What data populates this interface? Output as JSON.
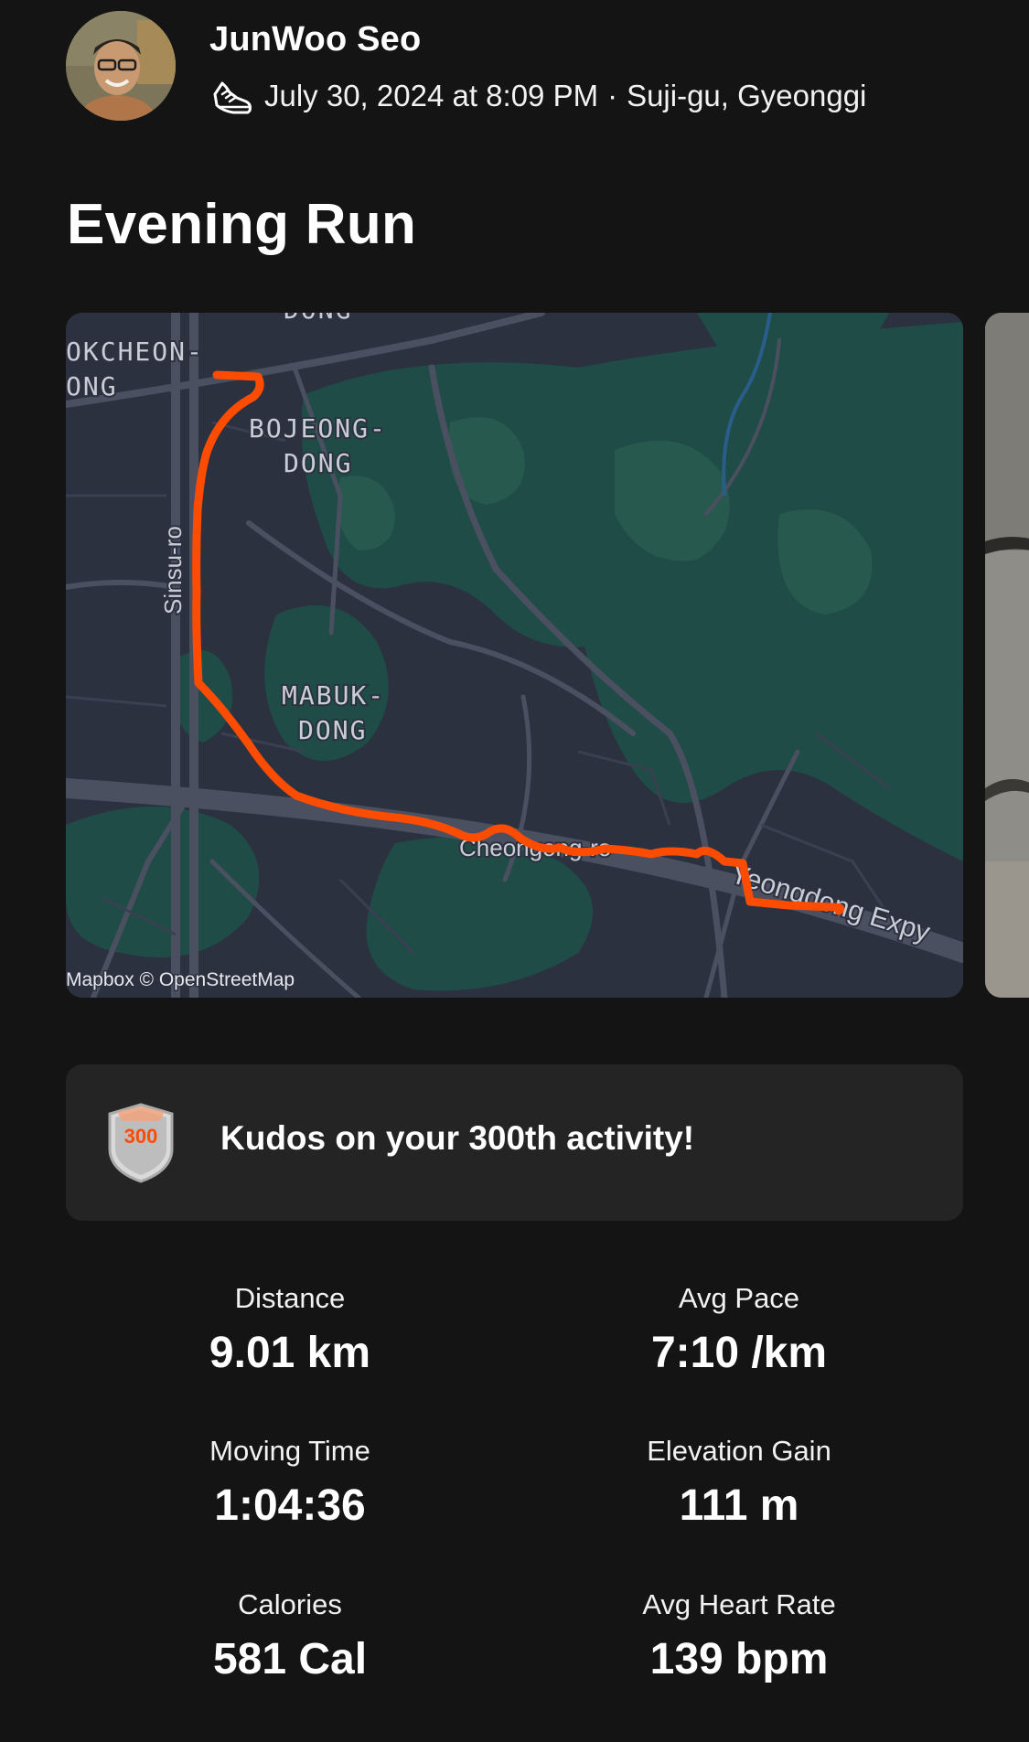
{
  "athlete": {
    "name": "JunWoo Seo",
    "date_time": "July 30, 2024 at 8:09 PM",
    "separator": "·",
    "location": "Suji-gu, Gyeonggi",
    "activity_icon": "running-shoe-icon"
  },
  "activity": {
    "title": "Evening Run"
  },
  "map": {
    "labels": {
      "dong_top": "DONG",
      "okcheon": "OKCHEON-",
      "okcheon_2": "ONG",
      "bojeong_1": "BOJEONG-",
      "bojeong_2": "DONG",
      "mabuk_1": "MABUK-",
      "mabuk_2": "DONG",
      "sinsu": "Sinsu-ro",
      "gyeongro": "Cheongong-ro",
      "expy": "Yeongdong Expy"
    },
    "attribution": "Mapbox © OpenStreetMap",
    "route_color": "#fc4c02",
    "land_color": "#2c3140",
    "park_color": "#1f4c47"
  },
  "kudos": {
    "badge_number": "300",
    "text": "Kudos on your 300th activity!"
  },
  "stats": [
    {
      "label": "Distance",
      "value": "9.01 km"
    },
    {
      "label": "Avg Pace",
      "value": "7:10 /km"
    },
    {
      "label": "Moving Time",
      "value": "1:04:36"
    },
    {
      "label": "Elevation Gain",
      "value": "111 m"
    },
    {
      "label": "Calories",
      "value": "581 Cal"
    },
    {
      "label": "Avg Heart Rate",
      "value": "139 bpm"
    }
  ]
}
